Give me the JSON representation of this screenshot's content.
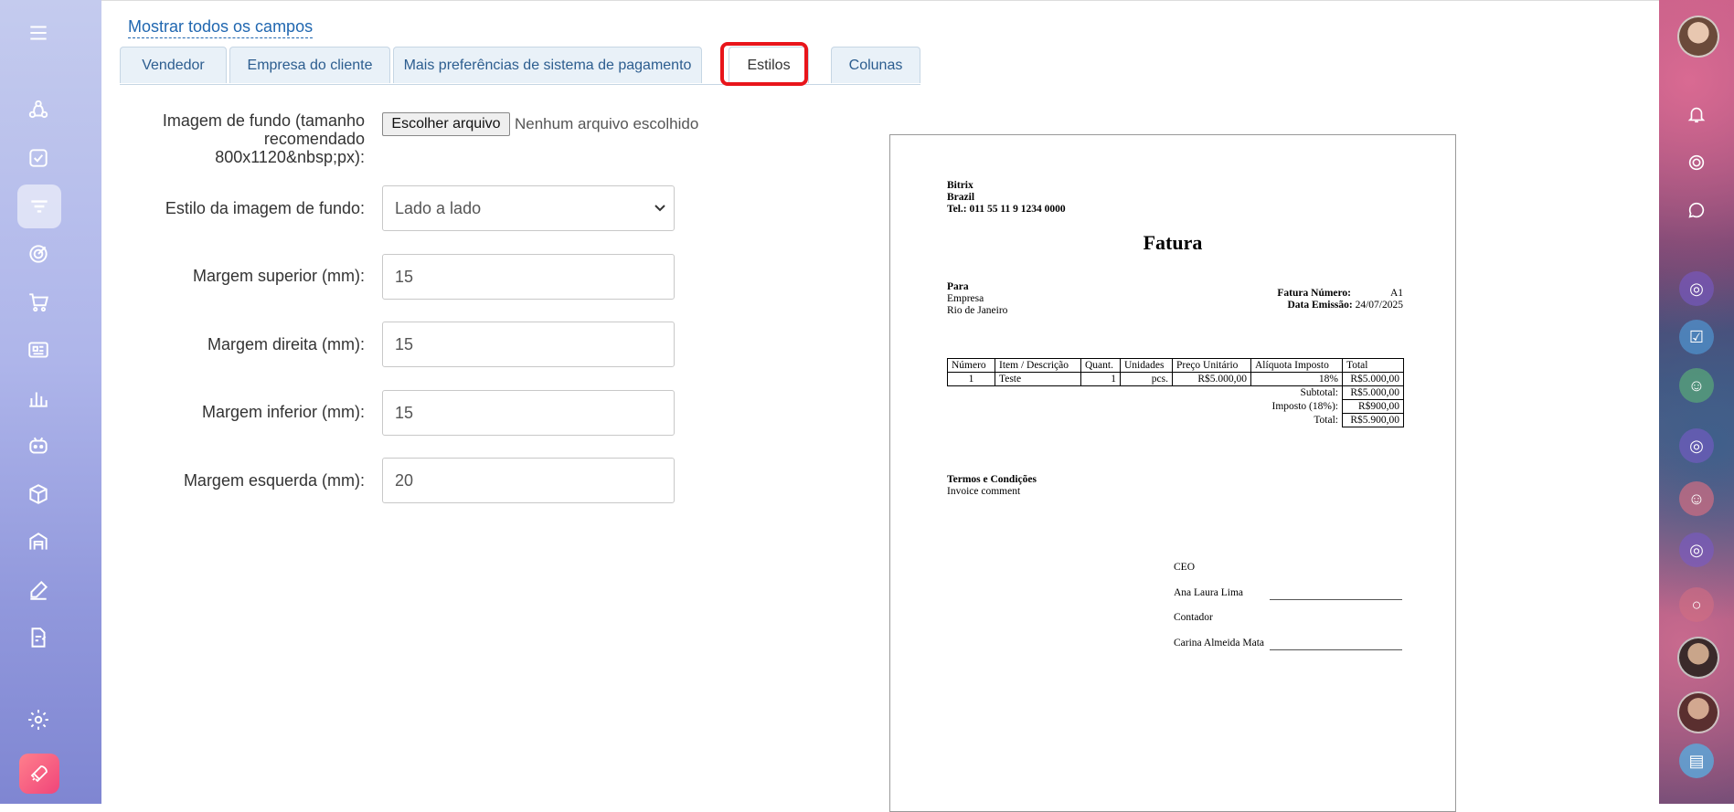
{
  "colors": {
    "accent": "#2067b0",
    "highlight": "#e8151b",
    "tab_bg": "#e9f1f8"
  },
  "sidebar": {
    "icons": [
      "menu-icon",
      "crm-flow-icon",
      "tasks-icon",
      "filter-icon",
      "target-icon",
      "cart-icon",
      "news-icon",
      "analytics-icon",
      "robot-icon",
      "box-icon",
      "warehouse-icon",
      "sign-icon",
      "document-edit-icon",
      "settings-icon",
      "rocket-icon"
    ]
  },
  "main": {
    "show_all_link": "Mostrar todos os campos",
    "tabs": [
      {
        "label": "Vendedor"
      },
      {
        "label": "Empresa do cliente"
      },
      {
        "label": "Mais preferências de sistema de pagamento"
      },
      {
        "label": "Estilos"
      },
      {
        "label": "Colunas"
      }
    ],
    "active_tab": "Estilos",
    "form": {
      "bg_image_label_1": "Imagem de fundo (tamanho",
      "bg_image_label_2": "recomendado",
      "bg_image_label_3": "800x1120&nbsp;px):",
      "file_button": "Escolher arquivo",
      "file_status": "Nenhum arquivo escolhido",
      "bg_style_label": "Estilo da imagem de fundo:",
      "bg_style_value": "Lado a lado",
      "margin_top_label": "Margem superior (mm):",
      "margin_top_value": "15",
      "margin_right_label": "Margem direita (mm):",
      "margin_right_value": "15",
      "margin_bottom_label": "Margem inferior (mm):",
      "margin_bottom_value": "15",
      "margin_left_label": "Margem esquerda (mm):",
      "margin_left_value": "20"
    }
  },
  "invoice": {
    "company": "Bitrix",
    "country": "Brazil",
    "phone": "Tel.: 011 55 11 9 1234 0000",
    "title": "Fatura",
    "to_label": "Para",
    "to_company": "Empresa",
    "to_city": "Rio de Janeiro",
    "number_label": "Fatura Número:",
    "number_value": "A1",
    "date_label": "Data Emissão:",
    "date_value": "24/07/2025",
    "table_headers": [
      "Número",
      "Item / Descrição",
      "Quant.",
      "Unidades",
      "Preço Unitário",
      "Alíquota Imposto",
      "Total"
    ],
    "row": [
      "1",
      "Teste",
      "1",
      "pcs.",
      "R$5.000,00",
      "18%",
      "R$5.000,00"
    ],
    "subtotal_label": "Subtotal:",
    "subtotal_value": "R$5.000,00",
    "tax_label": "Imposto (18%):",
    "tax_value": "R$900,00",
    "total_label": "Total:",
    "total_value": "R$5.900,00",
    "terms_title": "Termos e Condições",
    "terms_text": "Invoice comment",
    "sig1_role": "CEO",
    "sig1_name": "Ana Laura Lima",
    "sig2_role": "Contador",
    "sig2_name": "Carina Almeida Mata"
  },
  "right_panel": {
    "icons": [
      "user-avatar",
      "bell-icon",
      "activity-icon",
      "chat-icon",
      "open-channel-icon",
      "checklist-icon",
      "group-icon",
      "open-channel-icon",
      "group-icon",
      "open-channel-icon",
      "circle-icon",
      "contact-avatar",
      "contact-avatar",
      "messenger-icon"
    ]
  }
}
